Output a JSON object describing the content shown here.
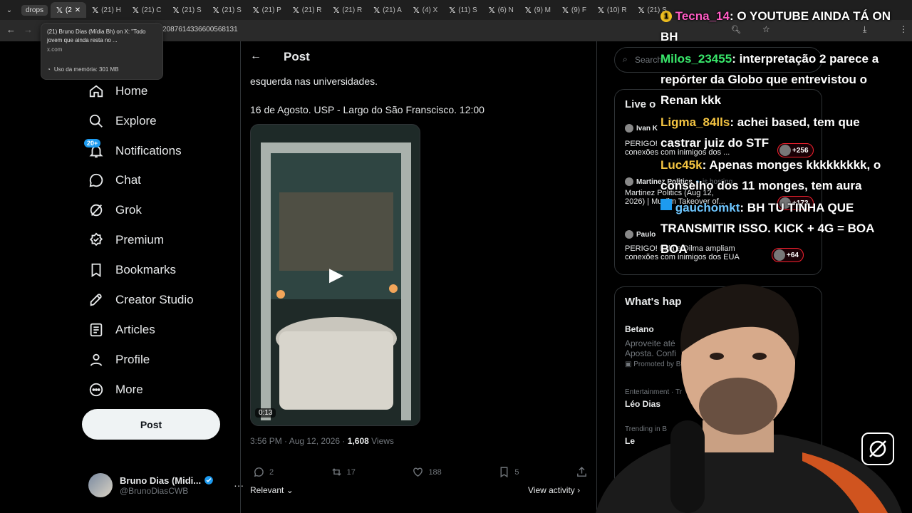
{
  "browser": {
    "tabs": [
      {
        "label": "drops"
      },
      {
        "label": "(2"
      },
      {
        "label": "(21) H"
      },
      {
        "label": "(21) C"
      },
      {
        "label": "(21) S"
      },
      {
        "label": "(21) S"
      },
      {
        "label": "(21) P"
      },
      {
        "label": "(21) R"
      },
      {
        "label": "(21) R"
      },
      {
        "label": "(21) A"
      },
      {
        "label": "(4) X"
      },
      {
        "label": "(11) S"
      },
      {
        "label": "(6) N"
      },
      {
        "label": "(9) M"
      },
      {
        "label": "(9) F"
      },
      {
        "label": "(10) R"
      },
      {
        "label": "(21) S"
      }
    ],
    "url": "2087614336600568131",
    "tooltip": {
      "title": "(21) Bruno Dias (Mídia Bh) on X: \"Todo jovem que ainda resta no ...",
      "domain": "x.com",
      "memory": "Uso da memória: 301 MB"
    }
  },
  "sidebar": {
    "items": [
      {
        "label": "Home",
        "icon": "home-icon"
      },
      {
        "label": "Explore",
        "icon": "search-icon"
      },
      {
        "label": "Notifications",
        "icon": "bell-icon"
      },
      {
        "label": "Chat",
        "icon": "chat-icon"
      },
      {
        "label": "Grok",
        "icon": "grok-icon"
      },
      {
        "label": "Premium",
        "icon": "premium-icon"
      },
      {
        "label": "Bookmarks",
        "icon": "bookmark-icon"
      },
      {
        "label": "Creator Studio",
        "icon": "rocket-icon"
      },
      {
        "label": "Articles",
        "icon": "article-icon"
      },
      {
        "label": "Profile",
        "icon": "person-icon"
      },
      {
        "label": "More",
        "icon": "more-icon"
      }
    ],
    "notifications_badge": "20+",
    "post_button": "Post",
    "account": {
      "name": "Bruno Dias (Midi...",
      "handle": "@BrunoDiasCWB"
    }
  },
  "main": {
    "header": "Post",
    "text_line1": "esquerda nas universidades.",
    "text_line2": "16 de Agosto. USP - Largo do São Franscisco. 12:00",
    "video_duration": "0:13",
    "meta_time": "3:56 PM · Aug 12, 2026 · ",
    "meta_views_count": "1,608",
    "meta_views_label": " Views",
    "actions": {
      "replies": "2",
      "reposts": "17",
      "likes": "188",
      "bookmarks": "5"
    },
    "relevant": "Relevant",
    "view_activity": "View activity"
  },
  "right": {
    "search_placeholder": "Search",
    "live_title": "Live o",
    "live_items": [
      {
        "host": "Ivan K",
        "title": "PERIGO!",
        "title2": "conexões com inimigos dos ...",
        "count": "+256"
      },
      {
        "host": "Martinez Politics",
        "host_status": "is hosting",
        "title": "Martinez Politics (Aug 12,",
        "title2": "2026) | Muslim Takeover of...",
        "count": "+173"
      },
      {
        "host": "Paulo",
        "title": "PERIGO! Lula e Dilma ampliam",
        "title2": "conexões com inimigos dos EUA",
        "count": "+64"
      }
    ],
    "whats_happening_title": "What's hap",
    "trends": [
      {
        "name": "Betano",
        "desc": "Aproveite até",
        "desc2": "Aposta. Confi",
        "promoted": "Promoted by B"
      },
      {
        "category": "Entertainment · Tr",
        "name": "Léo Dias"
      },
      {
        "category": "Trending in B",
        "name": "Le"
      }
    ]
  },
  "chat_overlay": [
    {
      "user": "Tecna_14",
      "message": ": O YOUTUBE AINDA TÁ ON BH"
    },
    {
      "user": "Milos_23455",
      "message": ": interpretação 2 parece a repórter da Globo que entrevistou o Renan kkk"
    },
    {
      "user": "Ligma_84lls",
      "message": ": achei based, tem que castrar juiz do STF"
    },
    {
      "user": "Luc45k",
      "message": ": Apenas monges kkkkkkkkk, o conselho dos 11 monges, tem aura"
    },
    {
      "user": "gauchomkt",
      "message": ": BH TU TINHA QUE TRANSMITIR ISSO. KICK + 4G = BOA BOA"
    }
  ]
}
